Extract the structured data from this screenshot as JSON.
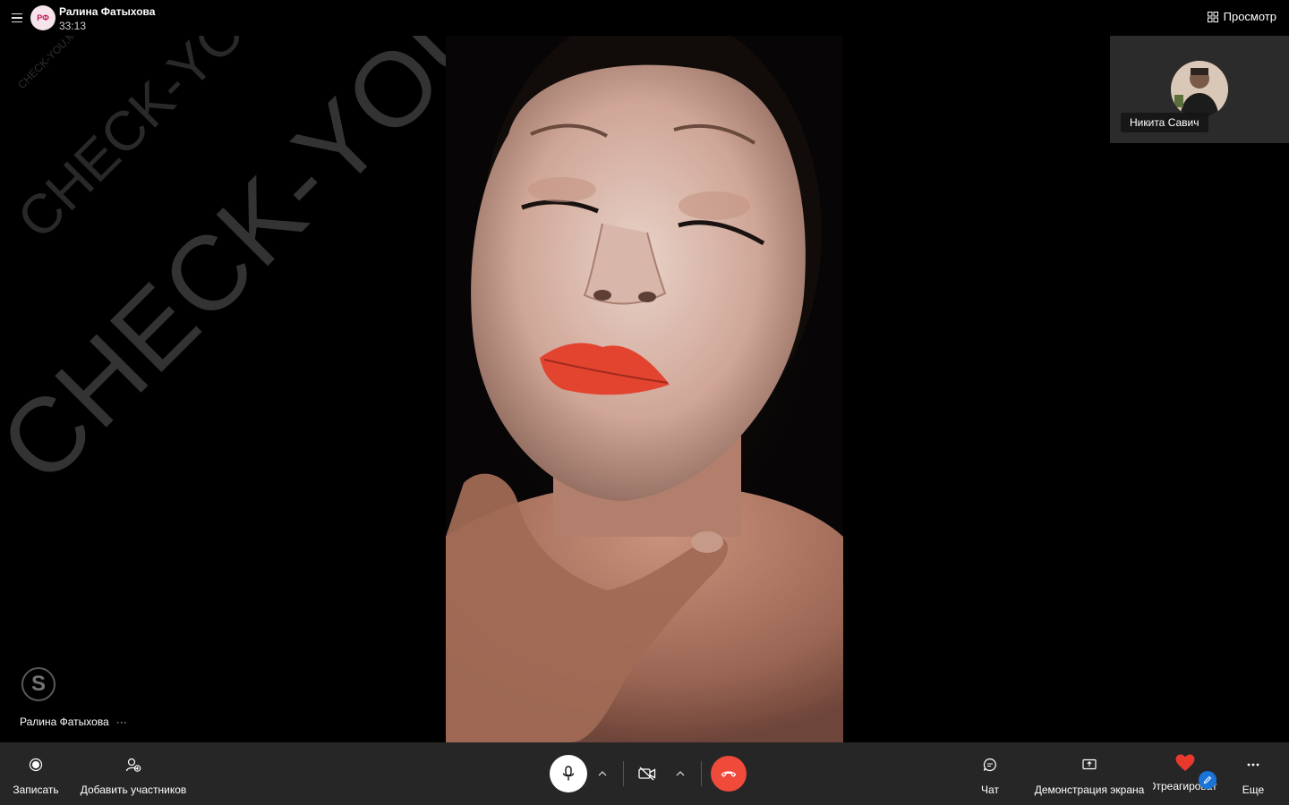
{
  "header": {
    "avatar_initials": "РФ",
    "caller_name": "Ралина Фатыхова",
    "timer": "33:13",
    "view_label": "Просмотр"
  },
  "stage": {
    "watermark_large": "CHECK-YOU.ME",
    "watermark_medium": "CHECK-YOU.ME",
    "watermark_small": "CHECK-YOU.ME",
    "skype_logo": "S",
    "participant_name": "Ралина Фатыхова",
    "participant_more": "···"
  },
  "self_preview": {
    "name": "Никита Савич"
  },
  "toolbar": {
    "record_label": "Записать",
    "add_people_label": "Добавить участников",
    "chat_label": "Чат",
    "share_screen_label": "Демонстрация экрана",
    "react_label": "Отреагировать",
    "more_label": "Еще"
  },
  "colors": {
    "toolbar_bg": "#262626",
    "hangup": "#ef4a3a",
    "heart": "#e8392c",
    "badge": "#1a73d9"
  },
  "icons": [
    "menu-icon",
    "grid-icon",
    "record-icon",
    "add-person-icon",
    "microphone-icon",
    "chevron-up-icon",
    "camera-off-icon",
    "hang-up-icon",
    "chat-icon",
    "share-screen-icon",
    "heart-icon",
    "pencil-icon",
    "more-icon",
    "skype-icon"
  ]
}
